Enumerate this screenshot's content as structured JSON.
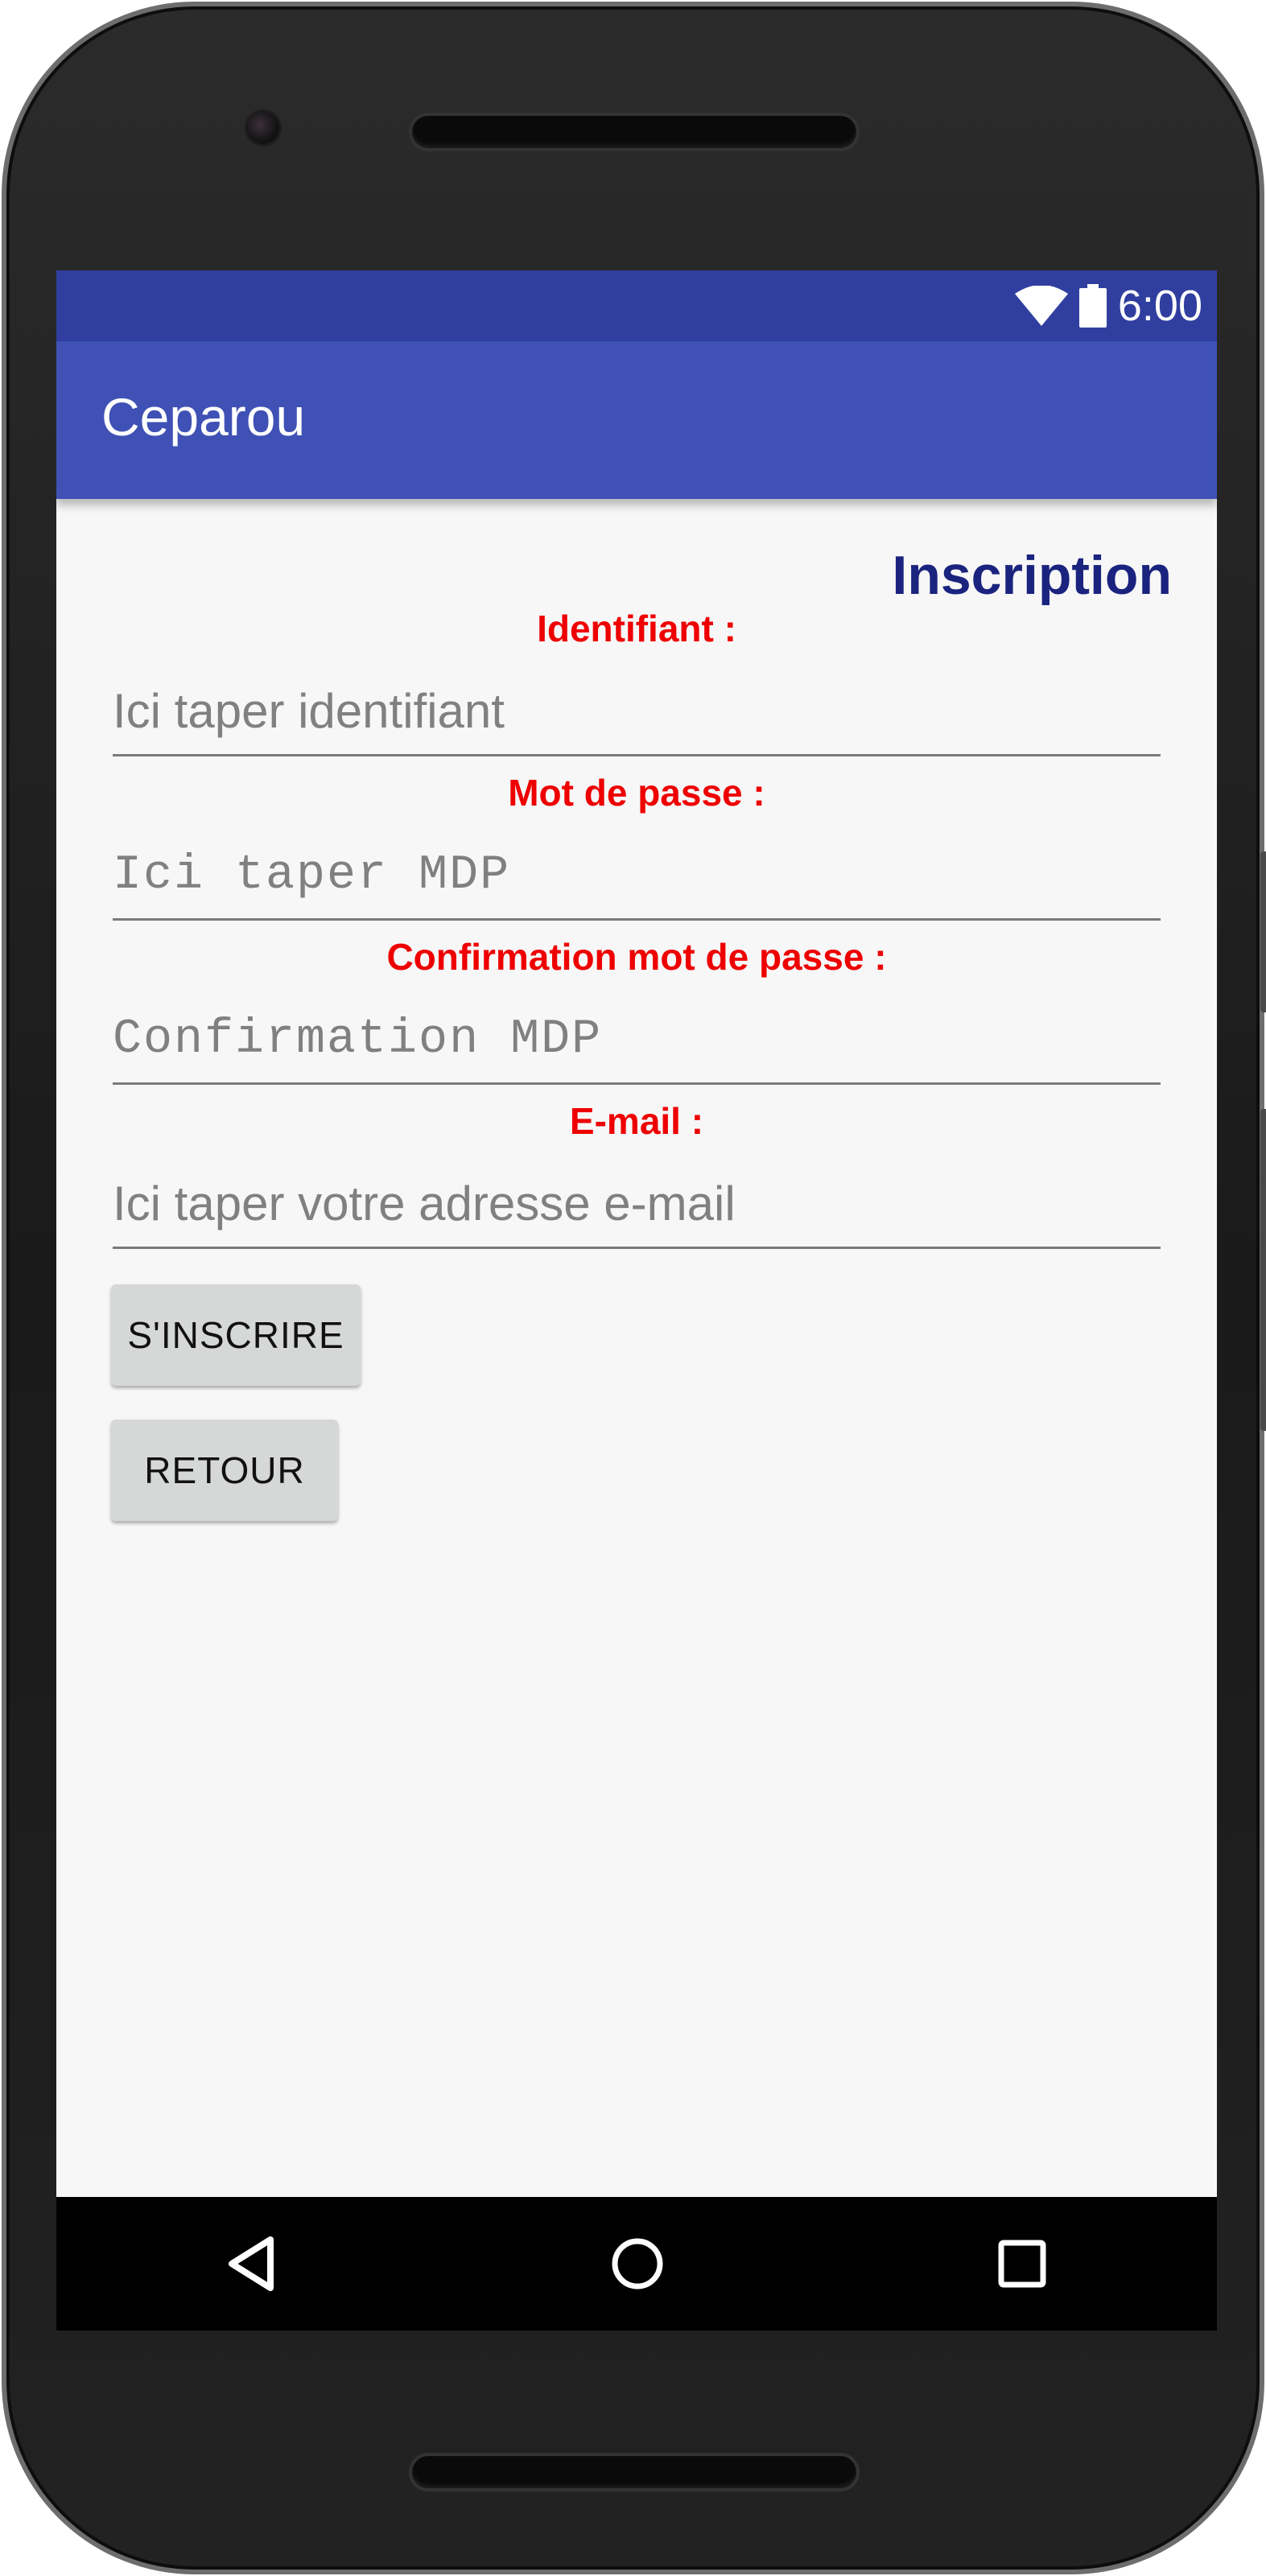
{
  "status_bar": {
    "time": "6:00",
    "icons": [
      "wifi-icon",
      "battery-icon"
    ]
  },
  "app_bar": {
    "title": "Ceparou"
  },
  "form": {
    "heading": "Inscription",
    "identifiant": {
      "label": "Identifiant :",
      "placeholder": "Ici taper identifiant"
    },
    "mot_de_passe": {
      "label": "Mot de passe :",
      "placeholder": "Ici taper MDP"
    },
    "confirmation": {
      "label": "Confirmation mot de passe :",
      "placeholder": "Confirmation MDP"
    },
    "email": {
      "label": "E-mail :",
      "placeholder": "Ici taper votre adresse e-mail"
    },
    "register_button": "S'INSCRIRE",
    "back_button": "RETOUR"
  },
  "nav_bar": {
    "icons": [
      "back-triangle-icon",
      "home-circle-icon",
      "recents-square-icon"
    ]
  },
  "colors": {
    "status_bar": "#303f9f",
    "app_bar": "#3f51b5",
    "heading": "#1a237e",
    "label": "#ee0000",
    "button": "#d6d7d7"
  }
}
